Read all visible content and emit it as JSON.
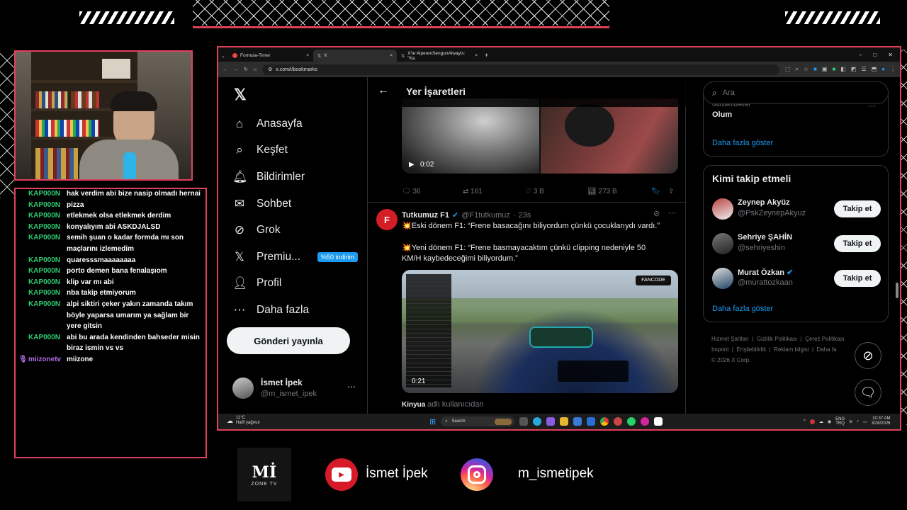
{
  "overlay": {
    "social_youtube": "İsmet İpek",
    "social_instagram": "m_ismetipek",
    "logo_text": "Mİ",
    "logo_sub": "ZONE TV"
  },
  "chat": {
    "messages": [
      {
        "user": "KAP000N",
        "text": "hak verdim abi bize nasip olmadı hernai"
      },
      {
        "user": "KAP000N",
        "text": "pizza"
      },
      {
        "user": "KAP000N",
        "text": "etlekmek olsa etlekmek derdim"
      },
      {
        "user": "KAP000N",
        "text": "konyalıyım abi ASKDJALSD"
      },
      {
        "user": "KAP000N",
        "text": "semih şuan o kadar formda mı son maçlarını izlemedim"
      },
      {
        "user": "KAP000N",
        "text": "quaresssmaaaaaaaa"
      },
      {
        "user": "KAP000N",
        "text": "porto demen bana fenalaşıom"
      },
      {
        "user": "KAP000N",
        "text": "klip var mı abi"
      },
      {
        "user": "KAP000N",
        "text": "nba takip etmiyorum"
      },
      {
        "user": "KAP000N",
        "text": "alpi siktiri çeker yakın zamanda takım böyle yaparsa umarım ya sağlam bir yere gitsin"
      },
      {
        "user": "KAP000N",
        "text": "abi bu arada kendinden bahseder misin biraz ismin vs vs"
      },
      {
        "user": "miizonetv",
        "text": "miizone"
      }
    ]
  },
  "browser": {
    "tabs": [
      "Formula-Timer",
      "X",
      "X'te AlperenSengunAlwayis: \"Ka"
    ],
    "url": "x.com/i/bookmarks"
  },
  "x": {
    "nav": [
      {
        "icon": "home-icon",
        "label": "Anasayfa"
      },
      {
        "icon": "search-icon",
        "label": "Keşfet"
      },
      {
        "icon": "bell-icon",
        "label": "Bildirimler"
      },
      {
        "icon": "mail-icon",
        "label": "Sohbet"
      },
      {
        "icon": "grok-icon",
        "label": "Grok"
      },
      {
        "icon": "x-icon",
        "label": "Premiu..."
      },
      {
        "icon": "person-icon",
        "label": "Profil"
      },
      {
        "icon": "more-icon",
        "label": "Daha fazla"
      }
    ],
    "premium_badge": "%50 indirim",
    "post_button": "Gönderi yayınla",
    "account": {
      "name": "İsmet İpek",
      "handle": "@m_ismet_ipek"
    },
    "header_title": "Yer İşaretleri",
    "video1_time": "0:02",
    "stats": {
      "replies": "36",
      "reposts": "161",
      "likes": "3 B",
      "views": "273 B"
    },
    "tweet": {
      "name": "Tutkumuz F1",
      "handle": "@F1tutkumuz",
      "time": "23s",
      "line1": "💥Eski dönem F1: “Frene basacağını biliyordum çünkü çocuklarıydı vardı.”",
      "line2": "💥Yeni dönem F1: “Frene basmayacaktım çünkü clipping nedeniyle 50 KM/H kaybedeceğimi biliyordum.”",
      "video_time": "0:21",
      "footer_user": "Kinyua",
      "footer_rest": "adlı kullanıcıdan"
    },
    "search_placeholder": "Ara",
    "trend_label": "Gündemdekiler",
    "trend_title": "Olum",
    "show_more": "Daha fazla göster",
    "wtf_title": "Kimi takip etmeli",
    "follow_label": "Takip et",
    "suggestions": [
      {
        "name": "Zeynep Akyüz",
        "handle": "@PskZeynepAkyuz",
        "verified": false
      },
      {
        "name": "Sehriye ŞAHİN",
        "handle": "@sehriyeshin",
        "verified": false
      },
      {
        "name": "Murat Özkan",
        "handle": "@murattozkaan",
        "verified": true
      }
    ],
    "show_more2": "Daha fazla göster",
    "footer_links": [
      "Hizmet Şartları",
      "Gizlilik Politikası",
      "Çerez Politikası",
      "Imprint",
      "Erişilebilirlik",
      "Reklam bilgisi",
      "Daha fa"
    ],
    "copyright": "© 2026 X Corp."
  },
  "taskbar": {
    "weather_temp": "11°C",
    "weather_desc": "Hafif yağmur",
    "search": "Search",
    "lang1": "ENG",
    "lang2": "TRQ",
    "time": "10:37 AM",
    "date": "3/28/2026"
  },
  "colors": {
    "accent": "#e0405a",
    "blue": "#1d9bf0",
    "chat_user": "#2ecc71"
  }
}
